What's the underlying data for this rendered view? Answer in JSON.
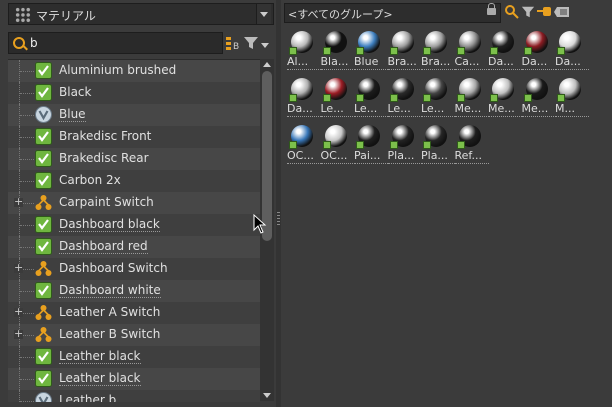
{
  "left_panel": {
    "material_dropdown": "マテリアル",
    "search_value": "b",
    "tree_items": [
      {
        "label": "Aluminium brushed",
        "type": "check",
        "underline": false,
        "expand": false
      },
      {
        "label": "Black",
        "type": "check",
        "underline": false,
        "expand": false
      },
      {
        "label": "Blue",
        "type": "v",
        "underline": true,
        "expand": false
      },
      {
        "label": "Brakedisc Front",
        "type": "check",
        "underline": false,
        "expand": false
      },
      {
        "label": "Brakedisc Rear",
        "type": "check",
        "underline": false,
        "expand": false
      },
      {
        "label": "Carbon 2x",
        "type": "check",
        "underline": false,
        "expand": false
      },
      {
        "label": "Carpaint Switch",
        "type": "switch",
        "underline": false,
        "expand": true
      },
      {
        "label": "Dashboard black",
        "type": "check",
        "underline": true,
        "expand": false
      },
      {
        "label": "Dashboard red",
        "type": "check",
        "underline": true,
        "expand": false
      },
      {
        "label": "Dashboard Switch",
        "type": "switch",
        "underline": false,
        "expand": true
      },
      {
        "label": "Dashboard white",
        "type": "check",
        "underline": true,
        "expand": false
      },
      {
        "label": "Leather A Switch",
        "type": "switch",
        "underline": false,
        "expand": true
      },
      {
        "label": "Leather B Switch",
        "type": "switch",
        "underline": false,
        "expand": true
      },
      {
        "label": "Leather black",
        "type": "check",
        "underline": true,
        "expand": false
      },
      {
        "label": "Leather black",
        "type": "check",
        "underline": true,
        "expand": false
      },
      {
        "label": "Leather b...",
        "type": "v",
        "underline": false,
        "expand": false
      }
    ]
  },
  "right_panel": {
    "group_dropdown": "<すべてのグループ>",
    "materials": [
      {
        "label": "Al...",
        "color": "#b9b9b9"
      },
      {
        "label": "Bla...",
        "color": "#111111"
      },
      {
        "label": "Blue",
        "color": "#3d7fc0"
      },
      {
        "label": "Bra...",
        "color": "#a0a0a0"
      },
      {
        "label": "Bra...",
        "color": "#a0a0a0"
      },
      {
        "label": "Ca...",
        "color": "#909090"
      },
      {
        "label": "Da...",
        "color": "#202020"
      },
      {
        "label": "Da...",
        "color": "#8c1b22"
      },
      {
        "label": "Da...",
        "color": "#d8d8d8"
      },
      {
        "label": "Da...",
        "color": "#b0b0b0"
      },
      {
        "label": "Le...",
        "color": "#9b1c24"
      },
      {
        "label": "Le...",
        "color": "#1c1c1c"
      },
      {
        "label": "Le...",
        "color": "#2a2a2a"
      },
      {
        "label": "Le...",
        "color": "#444444"
      },
      {
        "label": "Me...",
        "color": "#a6a6a6"
      },
      {
        "label": "Me...",
        "color": "#c0c0c0"
      },
      {
        "label": "Me...",
        "color": "#1a1a1a"
      },
      {
        "label": "M...",
        "color": "#bdbdbd"
      },
      {
        "label": "OC...",
        "color": "#3776b8"
      },
      {
        "label": "OC...",
        "color": "#c8c8c8"
      },
      {
        "label": "Pai...",
        "color": "#202020"
      },
      {
        "label": "Pla...",
        "color": "#232323"
      },
      {
        "label": "Pla...",
        "color": "#262626"
      },
      {
        "label": "Ref...",
        "color": "#1e1e1e"
      }
    ]
  }
}
